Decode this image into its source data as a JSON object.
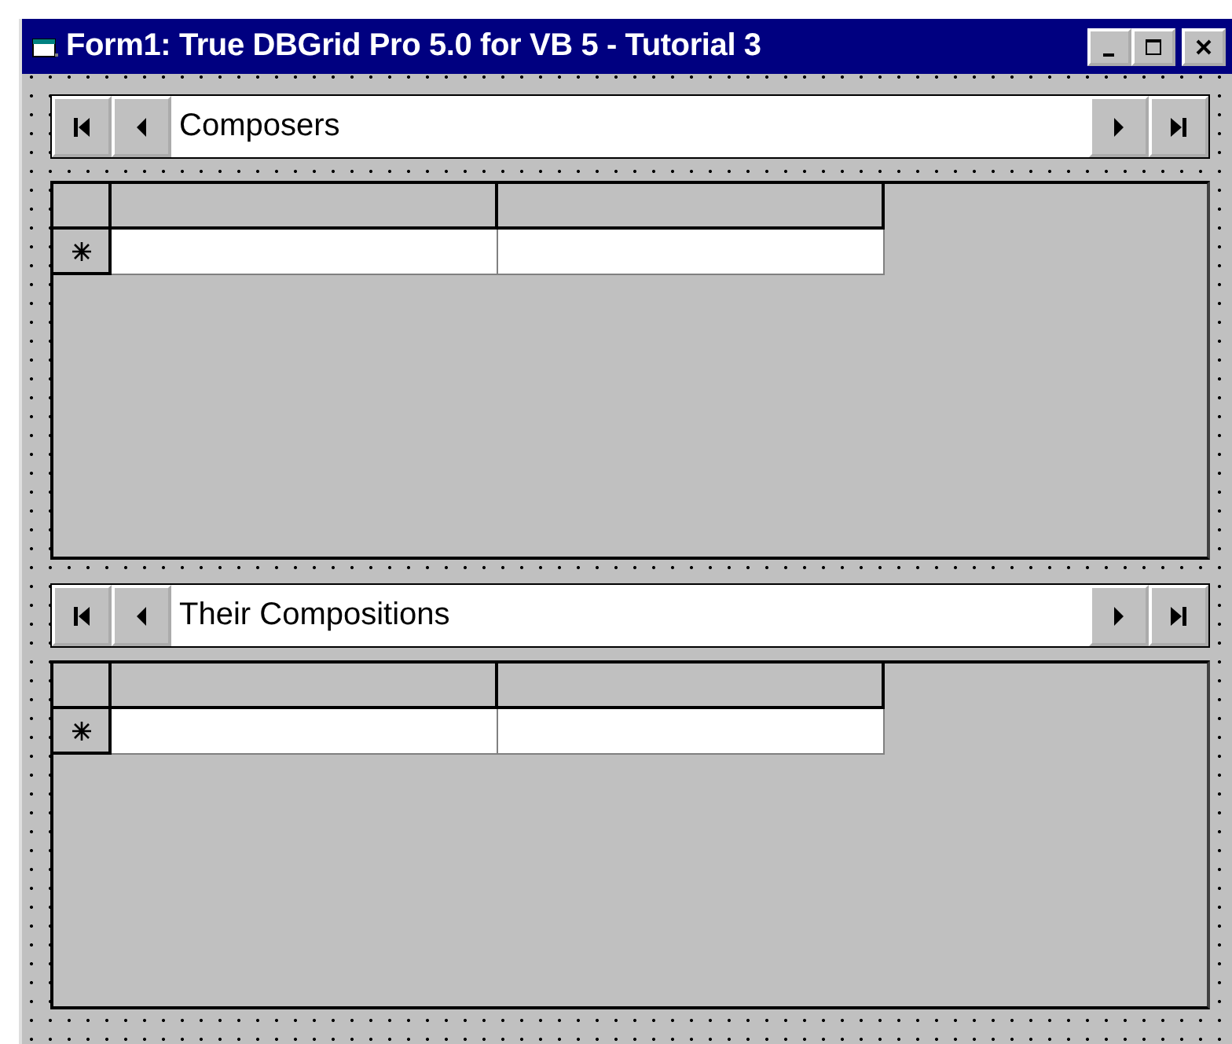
{
  "window": {
    "title": "Form1:  True DBGrid Pro 5.0 for VB 5 - Tutorial 3"
  },
  "panels": [
    {
      "caption": "Composers"
    },
    {
      "caption": "Their Compositions"
    }
  ]
}
